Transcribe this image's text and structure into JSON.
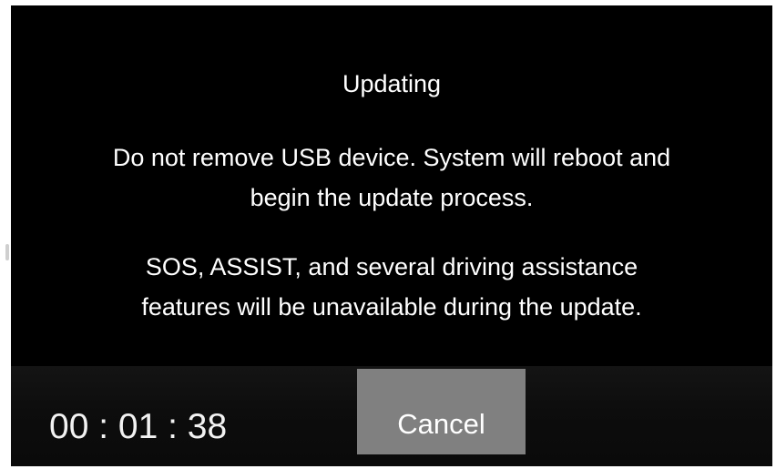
{
  "dialog": {
    "title": "Updating",
    "message_1_line_1": "Do not remove USB device. System will reboot and",
    "message_1_line_2": "begin the update process.",
    "message_2_line_1": "SOS, ASSIST, and several driving assistance",
    "message_2_line_2": "features will be unavailable during the update."
  },
  "footer": {
    "timer": "00 : 01 : 38",
    "cancel_label": "Cancel"
  },
  "colors": {
    "dialog_background": "#000000",
    "button_background": "#808080",
    "text": "#ffffff"
  }
}
